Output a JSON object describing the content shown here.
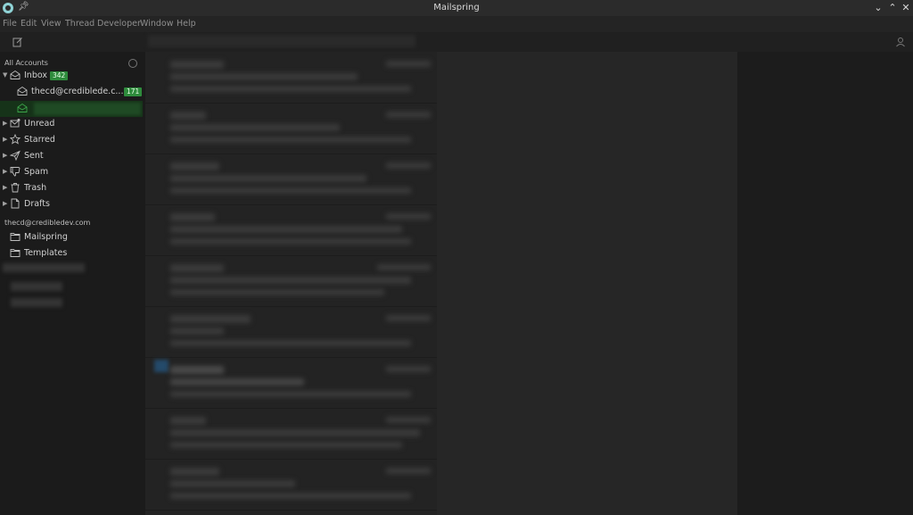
{
  "window": {
    "title": "Mailspring"
  },
  "menu": [
    "File",
    "Edit",
    "View",
    "Thread",
    "Developer",
    "Window",
    "Help"
  ],
  "sidebar": {
    "all_accounts_label": "All Accounts",
    "folders": [
      {
        "label": "Inbox",
        "badge": "342",
        "icon": "inbox-icon"
      },
      {
        "label": "thecd@crediblede.c...",
        "badge": "171",
        "icon": "inbox-icon"
      },
      {
        "label": "Unread",
        "icon": "unread-icon"
      },
      {
        "label": "Starred",
        "icon": "star-icon"
      },
      {
        "label": "Sent",
        "icon": "sent-icon"
      },
      {
        "label": "Spam",
        "icon": "thumbs-down-icon"
      },
      {
        "label": "Trash",
        "icon": "trash-icon"
      },
      {
        "label": "Drafts",
        "icon": "draft-icon"
      }
    ],
    "account_label": "thecd@credibledev.com",
    "account_folders": [
      {
        "label": "Mailspring",
        "icon": "folder-icon"
      },
      {
        "label": "Templates",
        "icon": "folder-icon"
      }
    ]
  },
  "colors": {
    "accent": "#2e8b3c",
    "background": "#1f1f1f"
  }
}
